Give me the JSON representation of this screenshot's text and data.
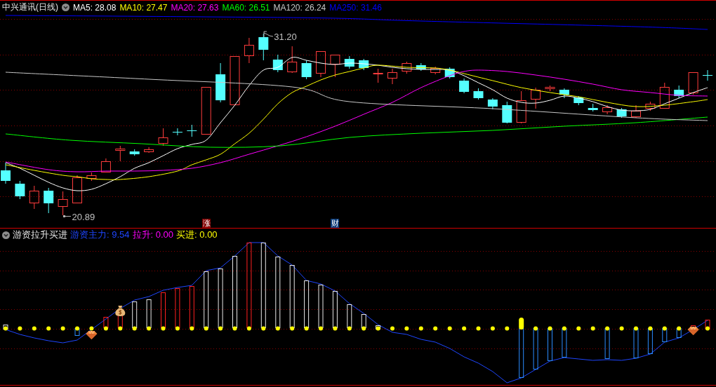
{
  "top_panel": {
    "title": "中兴通讯(日线)",
    "indicators": [
      {
        "label": "MA5: 28.08",
        "color": "#ffffff"
      },
      {
        "label": "MA10: 27.47",
        "color": "#ffff00"
      },
      {
        "label": "MA20: 27.63",
        "color": "#ff00ff"
      },
      {
        "label": "MA60: 26.51",
        "color": "#00ff00"
      },
      {
        "label": "MA120: 26.24",
        "color": "#c8c8c8"
      },
      {
        "label": "MA250: 31.46",
        "color": "#0000ff"
      }
    ],
    "high_label": "31.20",
    "low_label": "20.89",
    "markers": [
      {
        "text": "涨",
        "color": "#800000"
      },
      {
        "text": "财",
        "color": "#0c3c78"
      }
    ]
  },
  "bottom_panel": {
    "title": "游资拉升买进",
    "indicators": [
      {
        "label": "游资主力: 9.54",
        "color": "#1e46ff"
      },
      {
        "label": "拉升: 0.00",
        "color": "#ff00ff"
      },
      {
        "label": "买进: 0.00",
        "color": "#ffff00"
      }
    ]
  }
}
